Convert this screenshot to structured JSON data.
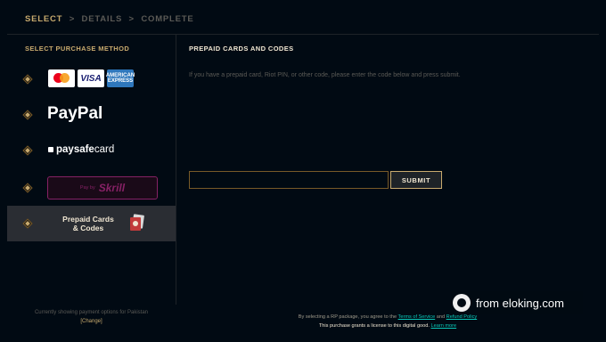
{
  "breadcrumb": {
    "step1": "SELECT",
    "sep1": ">",
    "step2": "DETAILS",
    "sep2": ">",
    "step3": "COMPLETE"
  },
  "sidebar": {
    "title": "SELECT PURCHASE METHOD",
    "methods": {
      "cards": {
        "visa": "VISA",
        "amex": "AMERICAN EXPRESS"
      },
      "paypal": "PayPal",
      "paysafecard": {
        "prefix": "paysafe",
        "suffix": "card"
      },
      "skrill": {
        "prefix": "Pay by",
        "name": "Skrill"
      },
      "prepaid": {
        "line1": "Prepaid Cards",
        "line2": "& Codes"
      }
    }
  },
  "main": {
    "title": "PREPAID CARDS AND CODES",
    "description": "If you have a prepaid card, Riot PIN, or other code, please enter the code below and press submit.",
    "code_input": {
      "value": "",
      "placeholder": ""
    },
    "submit_label": "SUBMIT"
  },
  "footer": {
    "region_text": "Currently showing payment options for  Pakistan",
    "change_label": "[Change]",
    "terms_prefix": "By selecting a RP package, you agree to the",
    "terms_link": "Terms of Service",
    "terms_and": "and",
    "privacy_link": "Refund Policy",
    "license_text": "This purchase grants a license to this digital good.",
    "learn_more": "Learn more"
  },
  "watermark": {
    "text": "from eloking.com"
  },
  "colors": {
    "background": "#010a13",
    "gold": "#c8aa6e",
    "gold_dark": "#785a28",
    "selected_row": "#2a2d33",
    "skrill": "#862165"
  }
}
